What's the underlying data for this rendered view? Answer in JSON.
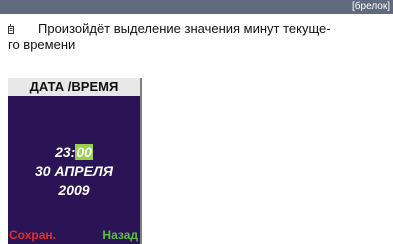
{
  "header": {
    "tag": "[брелок]",
    "bar_color": "#606a7f"
  },
  "note": {
    "icon": "remote-keyfob-icon",
    "text_line1": "Произойдёт выделение значения минут текуще-",
    "text_line2": "го времени"
  },
  "screen": {
    "title": "ДАТА /ВРЕМЯ",
    "hours": "23:",
    "minutes": "00",
    "date": "30 АПРЕЛЯ",
    "year": "2009",
    "softkey_left": "Сохран.",
    "softkey_right": "Назад",
    "colors": {
      "background": "#2a1456",
      "title_bar": "#e8e8e8",
      "selection": "#9ad14a",
      "softkey_left": "#e0302a",
      "softkey_right": "#58c23c"
    }
  }
}
